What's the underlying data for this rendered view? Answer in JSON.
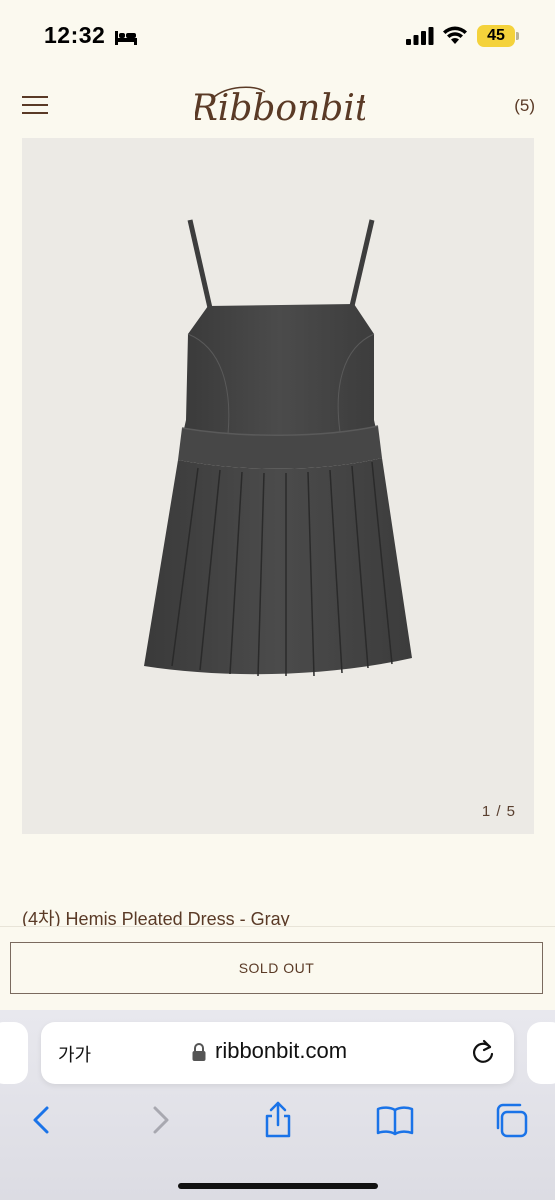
{
  "status_bar": {
    "time": "12:32",
    "battery": "45",
    "battery_color": "#f4d23b"
  },
  "header": {
    "logo_text": "Ribbonbit",
    "cart_count": "(5)",
    "brand_color": "#5a3a26"
  },
  "product": {
    "image_icon": "gray-pleated-dress-image",
    "image_counter": "1 / 5",
    "title": "(4차) Hemis Pleated Dress - Gray",
    "sold_out_label": "SOLD OUT"
  },
  "browser": {
    "text_size_label": "가가",
    "url": "ribbonbit.com",
    "icons": [
      "lock-icon",
      "reload-icon",
      "back-icon",
      "forward-icon",
      "share-icon",
      "bookmarks-icon",
      "tabs-icon"
    ]
  }
}
